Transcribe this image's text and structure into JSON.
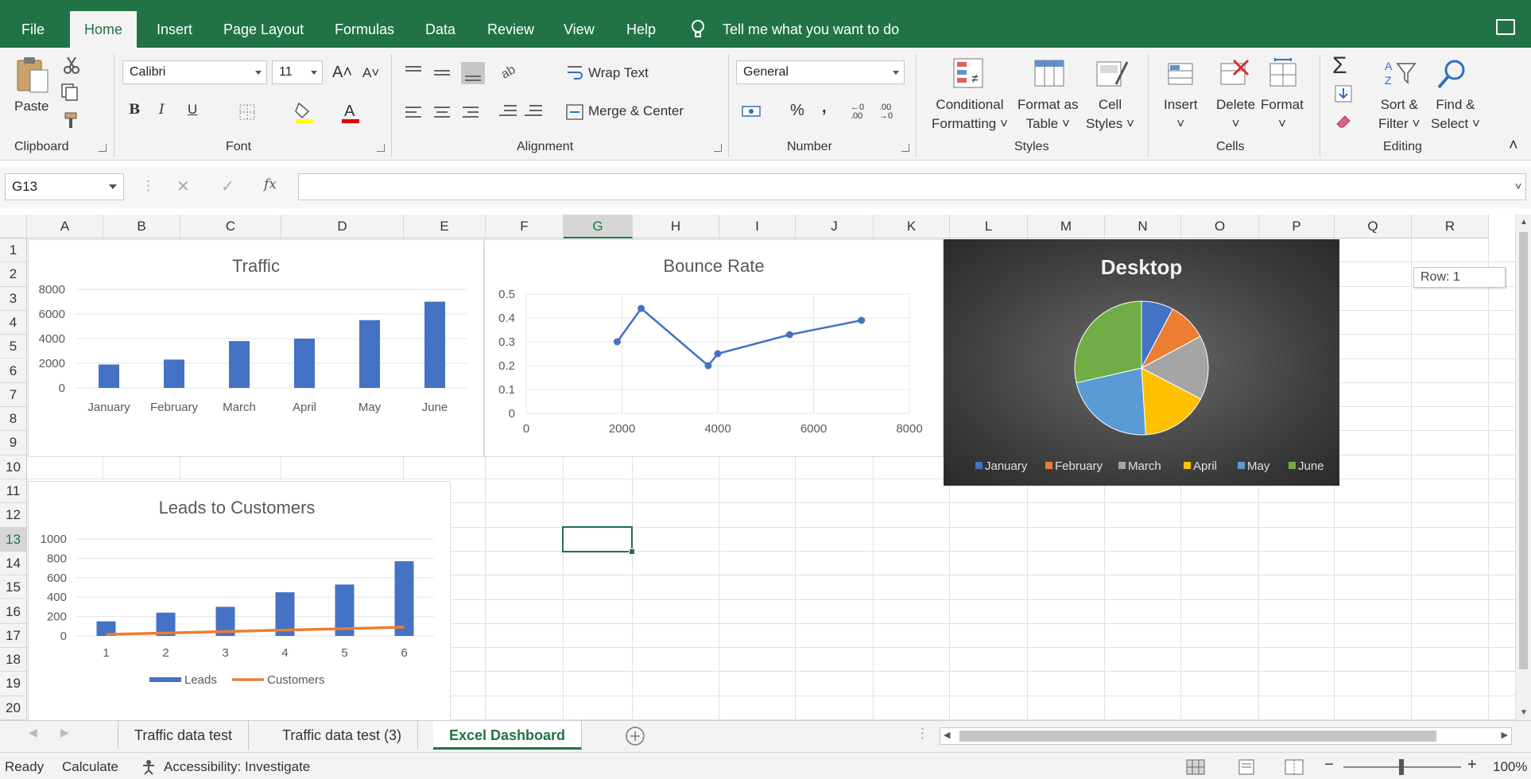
{
  "menu": {
    "tabs": [
      "File",
      "Home",
      "Insert",
      "Page Layout",
      "Formulas",
      "Data",
      "Review",
      "View",
      "Help"
    ],
    "active_tab": "Home",
    "tell_me": "Tell me what you want to do"
  },
  "ribbon": {
    "clipboard": {
      "paste": "Paste",
      "label": "Clipboard"
    },
    "font": {
      "name": "Calibri",
      "size": "11",
      "bold": "B",
      "italic": "I",
      "underline": "U",
      "label": "Font"
    },
    "alignment": {
      "wrap_text": "Wrap Text",
      "merge_center": "Merge & Center",
      "label": "Alignment"
    },
    "number": {
      "format": "General",
      "percent": "%",
      "comma": ",",
      "inc_decimal": "←0 .00",
      "dec_decimal": ".00 →0",
      "label": "Number"
    },
    "styles": {
      "conditional_1": "Conditional",
      "conditional_2": "Formatting",
      "format_table_1": "Format as",
      "format_table_2": "Table",
      "cell_styles_1": "Cell",
      "cell_styles_2": "Styles",
      "label": "Styles"
    },
    "cells": {
      "insert": "Insert",
      "delete": "Delete",
      "format": "Format",
      "label": "Cells"
    },
    "editing": {
      "sort_1": "Sort &",
      "sort_2": "Filter",
      "find_1": "Find &",
      "find_2": "Select",
      "label": "Editing"
    }
  },
  "formula_bar": {
    "name_box": "G13",
    "fx": "fx",
    "value": ""
  },
  "columns": [
    "A",
    "B",
    "C",
    "D",
    "E",
    "F",
    "G",
    "H",
    "I",
    "J",
    "K",
    "L",
    "M",
    "N",
    "O",
    "P",
    "Q",
    "R"
  ],
  "rows": [
    "1",
    "2",
    "3",
    "4",
    "5",
    "6",
    "7",
    "8",
    "9",
    "10",
    "11",
    "12",
    "13",
    "14",
    "15",
    "16",
    "17",
    "18",
    "19",
    "20"
  ],
  "selected": {
    "column": "G",
    "row": "13"
  },
  "tooltip": "Row: 1",
  "colors": {
    "excel_green": "#217346",
    "blue": "#4472c4",
    "orange": "#ed7d31",
    "gray": "#a5a5a5",
    "yellow": "#ffc000",
    "lightblue": "#5b9bd5",
    "green": "#70ad47"
  },
  "chart_data": [
    {
      "type": "bar",
      "title": "Traffic",
      "categories": [
        "January",
        "February",
        "March",
        "April",
        "May",
        "June"
      ],
      "values": [
        1900,
        2300,
        3800,
        4000,
        5500,
        7000
      ],
      "ylim": [
        0,
        8000
      ],
      "yticks": [
        "8000",
        "6000",
        "4000",
        "2000",
        "0"
      ]
    },
    {
      "type": "scatter",
      "title": "Bounce Rate",
      "x": [
        1900,
        2400,
        3800,
        4000,
        5500,
        7000
      ],
      "y": [
        0.3,
        0.44,
        0.2,
        0.25,
        0.33,
        0.39
      ],
      "xlim": [
        0,
        8000
      ],
      "ylim": [
        0,
        0.5
      ],
      "xticks": [
        "0",
        "2000",
        "4000",
        "6000",
        "8000"
      ],
      "yticks": [
        "0.5",
        "0.4",
        "0.3",
        "0.2",
        "0.1",
        "0"
      ]
    },
    {
      "type": "pie",
      "title": "Desktop",
      "categories": [
        "January",
        "February",
        "March",
        "April",
        "May",
        "June"
      ],
      "values": [
        1900,
        2300,
        3800,
        4000,
        5500,
        7000
      ],
      "colors": [
        "#4472c4",
        "#ed7d31",
        "#a5a5a5",
        "#ffc000",
        "#5b9bd5",
        "#70ad47"
      ]
    },
    {
      "type": "bar",
      "title": "Leads to Customers",
      "categories": [
        "1",
        "2",
        "3",
        "4",
        "5",
        "6"
      ],
      "series": [
        {
          "name": "Leads",
          "values": [
            150,
            240,
            300,
            450,
            530,
            770
          ]
        },
        {
          "name": "Customers",
          "values": [
            15,
            30,
            45,
            60,
            75,
            90
          ]
        }
      ],
      "ylim": [
        0,
        1000
      ],
      "yticks": [
        "1000",
        "800",
        "600",
        "400",
        "200",
        "0"
      ]
    }
  ],
  "sheet_tabs": [
    "Traffic data test",
    "Traffic data test (3)",
    "Excel Dashboard"
  ],
  "active_sheet": "Excel Dashboard",
  "status": {
    "ready": "Ready",
    "calculate": "Calculate",
    "accessibility": "Accessibility: Investigate",
    "zoom": "100%"
  }
}
